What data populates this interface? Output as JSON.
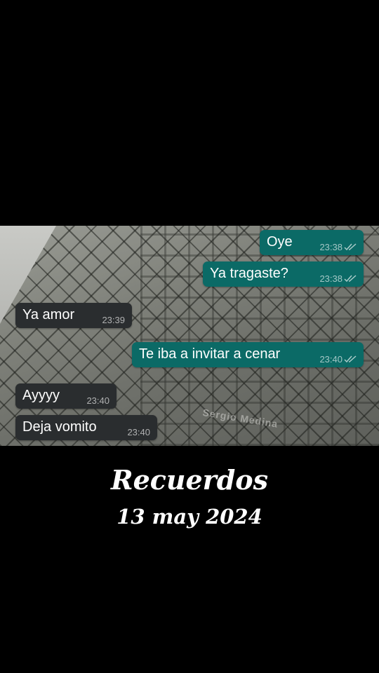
{
  "chat": {
    "messages": [
      {
        "text": "Oye",
        "time": "23:38",
        "direction": "outgoing",
        "status": "read"
      },
      {
        "text": "Ya tragaste?",
        "time": "23:38",
        "direction": "outgoing",
        "status": "read"
      },
      {
        "text": "Ya amor",
        "time": "23:39",
        "direction": "incoming"
      },
      {
        "text": "Te iba a invitar a cenar",
        "time": "23:40",
        "direction": "outgoing",
        "status": "read"
      },
      {
        "text": "Ayyyy",
        "time": "23:40",
        "direction": "incoming"
      },
      {
        "text": "Deja vomito",
        "time": "23:40",
        "direction": "incoming"
      }
    ],
    "watermark": "Sergio Medina",
    "colors": {
      "outgoing_bubble": "#0b6a66",
      "incoming_bubble": "#2a2d2f",
      "background": "#000000"
    },
    "read_icon": "double-check-icon"
  },
  "caption": {
    "title": "Recuerdos",
    "date": "13 may 2024"
  }
}
